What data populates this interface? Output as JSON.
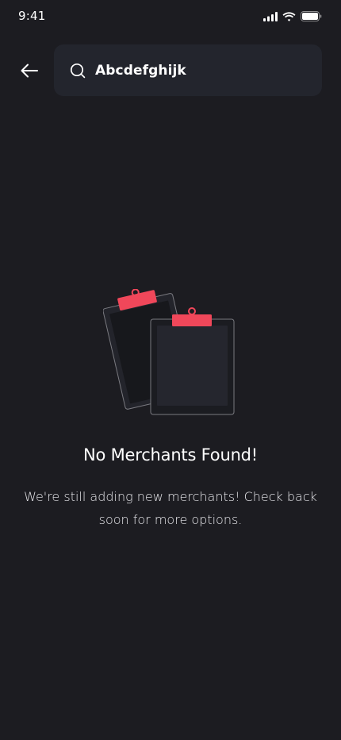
{
  "status_bar": {
    "time": "9:41",
    "icons": [
      "cellular-signal-icon",
      "wifi-icon",
      "battery-icon"
    ]
  },
  "header": {
    "back_icon": "arrow-left-icon",
    "search": {
      "icon": "search-icon",
      "value": "Abcdefghijk",
      "placeholder": ""
    }
  },
  "empty_state": {
    "illustration": "clipboards-illustration",
    "title": "No Merchants Found!",
    "message": "We're still adding new merchants! Check back soon for more options."
  },
  "colors": {
    "background": "#1c1c21",
    "search_background": "#23252d",
    "accent": "#f0475a",
    "text": "#ffffff"
  }
}
